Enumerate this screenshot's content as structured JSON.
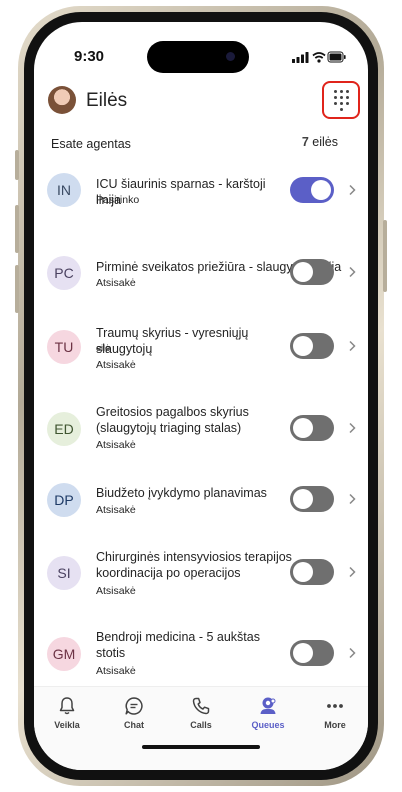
{
  "status_bar": {
    "time": "9:30"
  },
  "header": {
    "title": "Eilės"
  },
  "agent_bar": {
    "label": "Esate agentas",
    "count": "7",
    "count_suffix": " eilės"
  },
  "queues": [
    {
      "initials": "IN",
      "name": "ICU šiaurinis sparnas - karštoji linija",
      "status": "Pasirinko",
      "avatar_bg": "#cfdcef",
      "avatar_fg": "#3a4a63",
      "toggle_on": true
    },
    {
      "initials": "PC",
      "name": "Pirminė sveikatos priežiūra - slaugytojų linija",
      "status": "Atsisakė",
      "avatar_bg": "#e6e1f2",
      "avatar_fg": "#4a4160",
      "toggle_on": false
    },
    {
      "initials": "TU",
      "name": "Traumų skyrius - vyresniųjų slaugytojų",
      "name_extra": "eilė",
      "status": "Atsisakė",
      "avatar_bg": "#f6d7e0",
      "avatar_fg": "#6d3345",
      "toggle_on": false
    },
    {
      "initials": "ED",
      "name": "Greitosios pagalbos skyrius (slaugytojų triaging stalas)",
      "status": "Atsisakė",
      "avatar_bg": "#e6efdc",
      "avatar_fg": "#3f5530",
      "toggle_on": false
    },
    {
      "initials": "DP",
      "name": "Biudžeto įvykdymo planavimas",
      "status": "Atsisakė",
      "avatar_bg": "#cfdcef",
      "avatar_fg": "#1e3a66",
      "toggle_on": false
    },
    {
      "initials": "SI",
      "name": "Chirurginės intensyviosios terapijos koordinacija po operacijos",
      "status": "Atsisakė",
      "avatar_bg": "#e6e1f2",
      "avatar_fg": "#4a4160",
      "toggle_on": false
    },
    {
      "initials": "GM",
      "name": "Bendroji medicina - 5 aukštas stotis",
      "status": "Atsisakė",
      "avatar_bg": "#f6d7e0",
      "avatar_fg": "#6d3345",
      "toggle_on": false
    }
  ],
  "nav": [
    {
      "label": "Veikla",
      "icon": "bell-icon",
      "active": false
    },
    {
      "label": "Chat",
      "icon": "chat-icon",
      "active": false
    },
    {
      "label": "Calls",
      "icon": "phone-icon",
      "active": false
    },
    {
      "label": "Queues",
      "icon": "queues-icon",
      "active": true
    },
    {
      "label": "More",
      "icon": "more-icon",
      "active": false
    }
  ],
  "colors": {
    "accent": "#5b5fc7",
    "highlight_border": "#e0241b"
  }
}
